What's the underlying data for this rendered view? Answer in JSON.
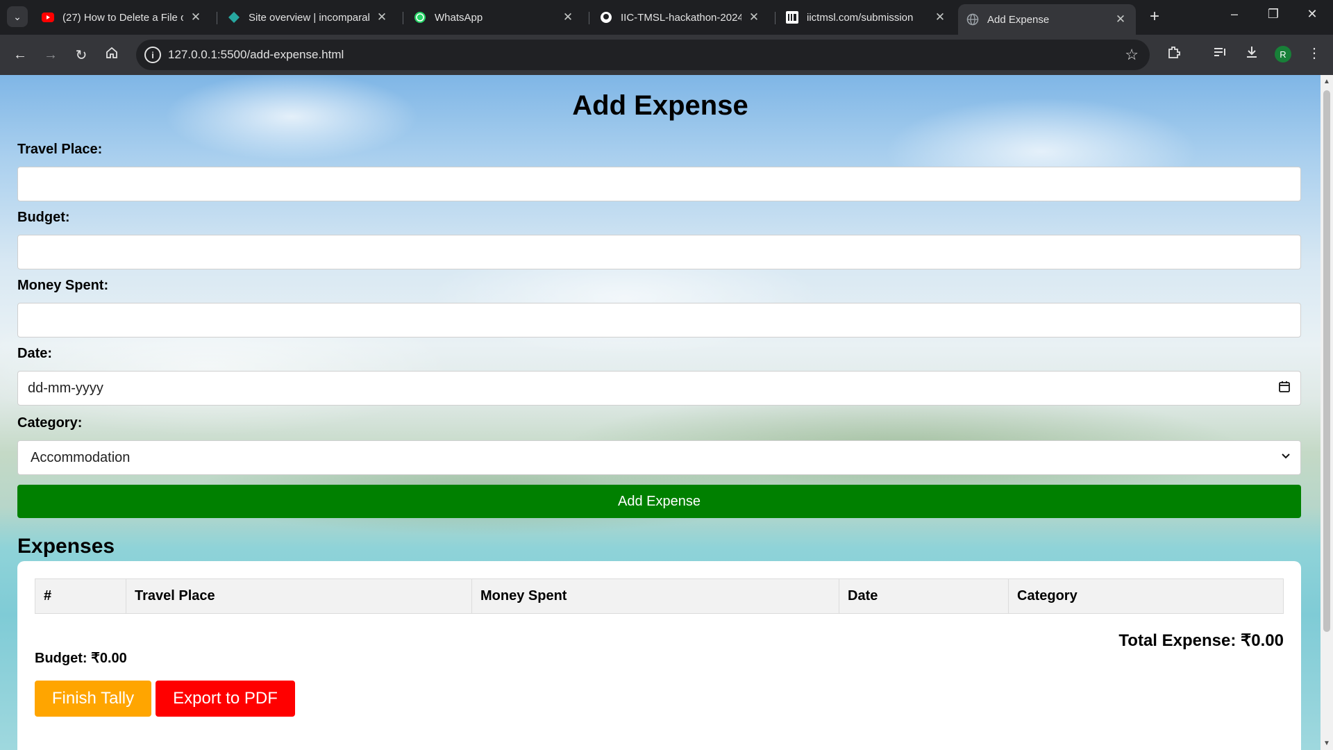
{
  "browser": {
    "tabs": [
      {
        "title": "(27) How to Delete a File o",
        "icon": "youtube-icon",
        "icon_color": "#ff0000"
      },
      {
        "title": "Site overview | incomparab",
        "icon": "netlify-icon",
        "icon_color": "#27a8a0"
      },
      {
        "title": "WhatsApp",
        "icon": "whatsapp-icon",
        "icon_color": "#25d366"
      },
      {
        "title": "IIC-TMSL-hackathon-2024",
        "icon": "github-icon",
        "icon_color": "#ffffff"
      },
      {
        "title": "iictmsl.com/submission",
        "icon": "iic-icon",
        "icon_color": "#ffffff"
      },
      {
        "title": "Add Expense",
        "icon": "globe-icon",
        "icon_color": "#9aa0a6"
      }
    ],
    "address": "127.0.0.1:5500/add-expense.html",
    "profile_initial": "R",
    "profile_color": "#188038"
  },
  "form": {
    "title": "Add Expense",
    "travel_place_label": "Travel Place:",
    "budget_label": "Budget:",
    "money_spent_label": "Money Spent:",
    "date_label": "Date:",
    "date_placeholder": "dd-mm-yyyy",
    "category_label": "Category:",
    "category_selected": "Accommodation",
    "submit_label": "Add Expense",
    "submit_color": "#008000"
  },
  "expenses": {
    "title": "Expenses",
    "columns": [
      "#",
      "Travel Place",
      "Money Spent",
      "Date",
      "Category"
    ],
    "rows": [],
    "total_label": "Total Expense: ₹0.00",
    "budget_label": "Budget: ₹0.00",
    "finish_label": "Finish Tally",
    "finish_color": "#ffa500",
    "export_label": "Export to PDF",
    "export_color": "#ff0000"
  }
}
